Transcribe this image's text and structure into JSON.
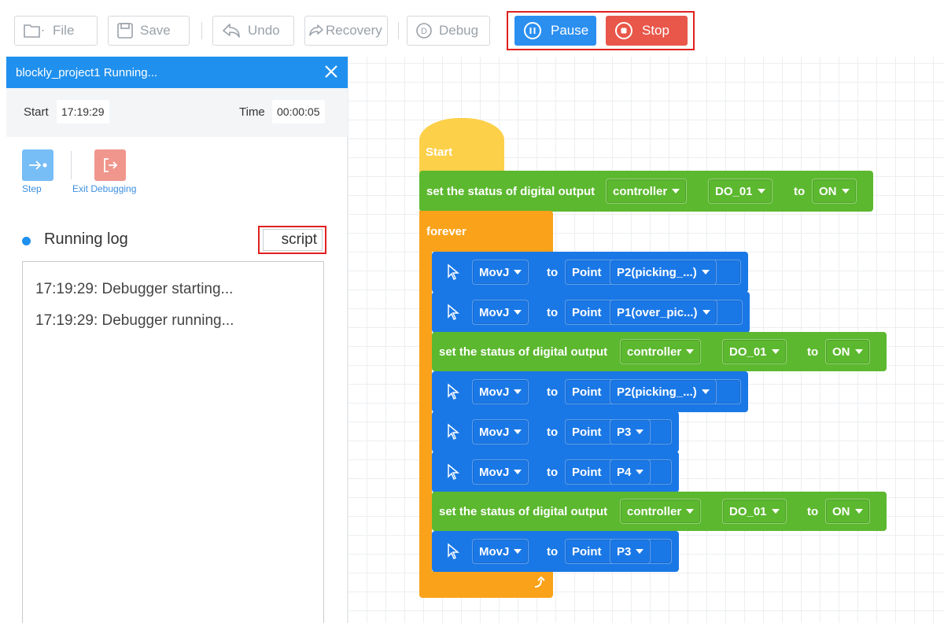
{
  "toolbar": {
    "file_label": "File",
    "save_label": "Save",
    "undo_label": "Undo",
    "recovery_label": "Recovery",
    "debug_label": "Debug",
    "pause_label": "Pause",
    "stop_label": "Stop"
  },
  "panel": {
    "title": "blockly_project1 Running...",
    "start_label": "Start",
    "start_value": "17:19:29",
    "time_label": "Time",
    "time_value": "00:00:05",
    "step_label": "Step",
    "exit_label": "Exit Debugging",
    "log_title": "Running log",
    "script_label": "script",
    "log_lines": [
      "17:19:29: Debugger starting...",
      "17:19:29: Debugger running..."
    ]
  },
  "blocks": {
    "start": "Start",
    "forever": "forever",
    "set_do_text": "set the status of digital output",
    "controller": "controller",
    "do_port": "DO_01",
    "to": "to",
    "on": "ON",
    "movj": "MovJ",
    "point": "Point",
    "p2": "P2(picking_...)",
    "p1": "P1(over_pic...)",
    "p3": "P3",
    "p4": "P4"
  },
  "colors": {
    "accent_blue": "#1f90ee",
    "stop_red": "#e8574a",
    "highlight_red": "#e02020",
    "block_green": "#5cb82f",
    "block_blue": "#1a78e6",
    "block_orange": "#f9a21a",
    "block_yellow": "#fdd049"
  }
}
